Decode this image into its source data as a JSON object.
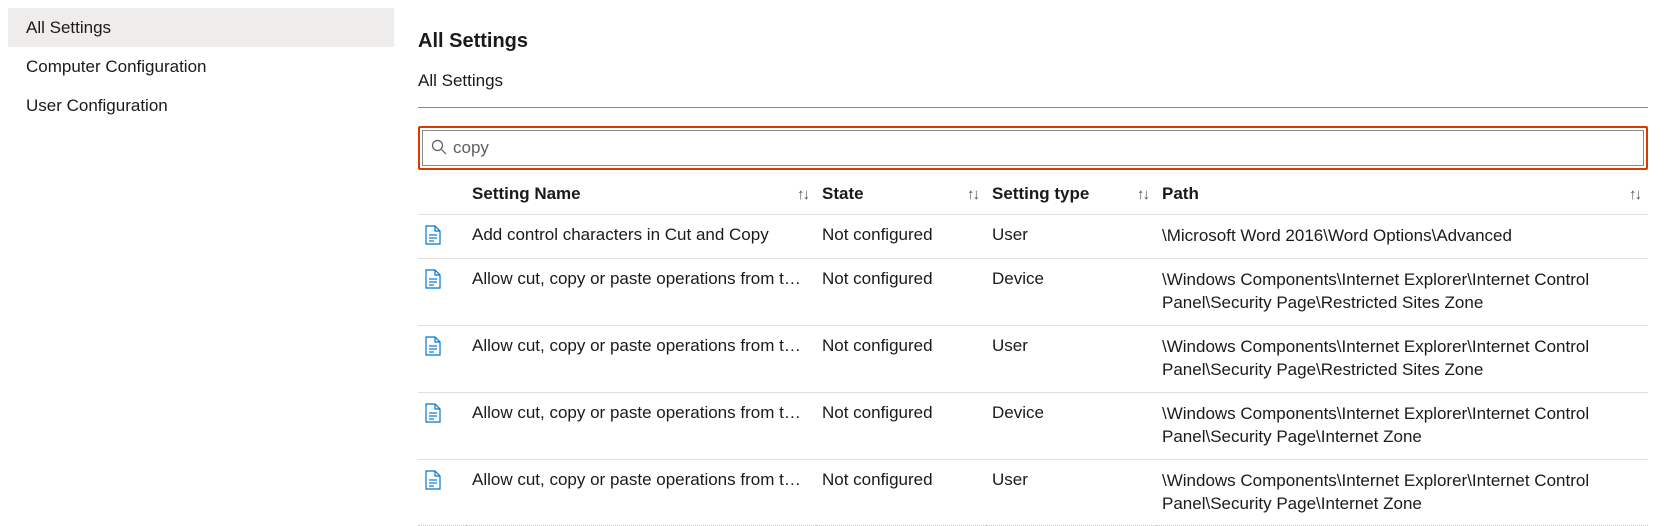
{
  "sidebar": {
    "items": [
      {
        "label": "All Settings",
        "selected": true
      },
      {
        "label": "Computer Configuration",
        "selected": false
      },
      {
        "label": "User Configuration",
        "selected": false
      }
    ]
  },
  "page": {
    "title": "All Settings",
    "breadcrumb": "All Settings"
  },
  "search": {
    "value": "copy",
    "placeholder": ""
  },
  "table": {
    "columns": [
      "Setting Name",
      "State",
      "Setting type",
      "Path"
    ],
    "rows": [
      {
        "name": "Add control characters in Cut and Copy",
        "state": "Not configured",
        "type": "User",
        "path": "\\Microsoft Word 2016\\Word Options\\Advanced"
      },
      {
        "name": "Allow cut, copy or paste operations from the clipboard via script",
        "state": "Not configured",
        "type": "Device",
        "path": "\\Windows Components\\Internet Explorer\\Internet Control Panel\\Security Page\\Restricted Sites Zone"
      },
      {
        "name": "Allow cut, copy or paste operations from the clipboard via script",
        "state": "Not configured",
        "type": "User",
        "path": "\\Windows Components\\Internet Explorer\\Internet Control Panel\\Security Page\\Restricted Sites Zone"
      },
      {
        "name": "Allow cut, copy or paste operations from the clipboard via script",
        "state": "Not configured",
        "type": "Device",
        "path": "\\Windows Components\\Internet Explorer\\Internet Control Panel\\Security Page\\Internet Zone"
      },
      {
        "name": "Allow cut, copy or paste operations from the clipboard via script",
        "state": "Not configured",
        "type": "User",
        "path": "\\Windows Components\\Internet Explorer\\Internet Control Panel\\Security Page\\Internet Zone"
      }
    ]
  }
}
